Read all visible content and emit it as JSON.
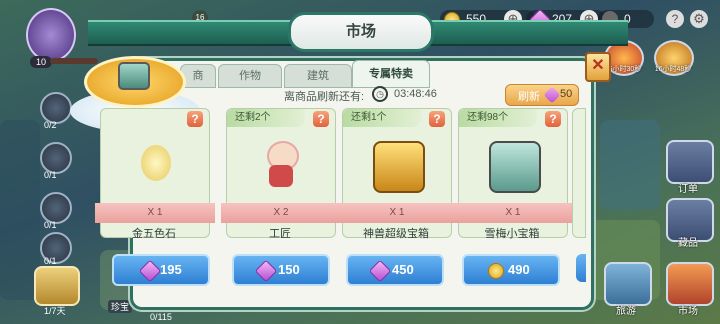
{
  "topbar": {
    "level_badge": "16",
    "coins": "550",
    "gems": "207",
    "stars": "0"
  },
  "player": {
    "level": "10"
  },
  "left_column": [
    {
      "count": "0/2"
    },
    {
      "count": "0/1"
    },
    {
      "count": "0/1"
    },
    {
      "count": "0/1"
    },
    {
      "count": "1/7天"
    }
  ],
  "bottom_left": {
    "label": "珍宝",
    "progress": "0/115"
  },
  "right_column": [
    {
      "label": "16小时30秒"
    },
    {
      "label": "16小时48秒"
    },
    {
      "label": "订单"
    },
    {
      "label": "藏品"
    },
    {
      "label": "市场"
    }
  ],
  "bottom_right": {
    "label": "旅游"
  },
  "market": {
    "title": "市场",
    "tabs": [
      "商",
      "作物",
      "建筑",
      "专属特卖"
    ],
    "active_tab": 3,
    "refresh_label": "离商品刷新还有:",
    "countdown": "03:48:46",
    "refresh_button": "刷新",
    "refresh_cost": "50",
    "items": [
      {
        "remaining": "",
        "qty": "X 1",
        "name": "金五色石",
        "price": "195",
        "currency": "gem"
      },
      {
        "remaining": "还剩2个",
        "qty": "X 2",
        "name": "工匠",
        "price": "150",
        "currency": "gem"
      },
      {
        "remaining": "还剩1个",
        "qty": "X 1",
        "name": "神兽超级宝箱",
        "price": "450",
        "currency": "gem"
      },
      {
        "remaining": "还剩98个",
        "qty": "X 1",
        "name": "雪梅小宝箱",
        "price": "490",
        "currency": "coin"
      }
    ]
  },
  "colors": {
    "panel_border": "#2f7060",
    "price_button": "#2f7fd3",
    "refresh_button": "#e9a64b",
    "ribbon": "#eaa19d"
  }
}
